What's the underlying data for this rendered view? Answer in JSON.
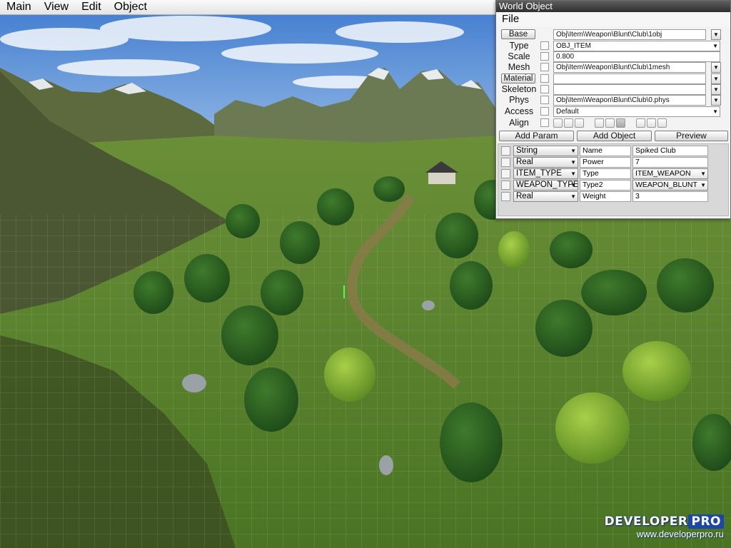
{
  "main_menu": [
    "Main",
    "View",
    "Edit",
    "Object"
  ],
  "world_object": {
    "title": "World Object",
    "menu": [
      "File"
    ],
    "properties": {
      "base": {
        "label": "Base",
        "value": "Obj\\Item\\Weapon\\Blunt\\Club\\1obj"
      },
      "type": {
        "label": "Type",
        "value": "OBJ_ITEM"
      },
      "scale": {
        "label": "Scale",
        "value": "0.800"
      },
      "mesh": {
        "label": "Mesh",
        "value": "Obj\\Item\\Weapon\\Blunt\\Club\\1mesh"
      },
      "material": {
        "label": "Material",
        "value": ""
      },
      "skeleton": {
        "label": "Skeleton",
        "value": ""
      },
      "phys": {
        "label": "Phys",
        "value": "Obj\\Item\\Weapon\\Blunt\\Club\\0.phys"
      },
      "access": {
        "label": "Access",
        "value": "Default"
      },
      "align": {
        "label": "Align"
      }
    },
    "actions": {
      "add_param": "Add Param",
      "add_object": "Add Object",
      "preview": "Preview"
    },
    "params": [
      {
        "type": "String",
        "name": "Name",
        "value": "Spiked Club"
      },
      {
        "type": "Real",
        "name": "Power",
        "value": "7"
      },
      {
        "type": "ITEM_TYPE",
        "name": "Type",
        "value": "ITEM_WEAPON"
      },
      {
        "type": "WEAPON_TYPE",
        "name": "Type2",
        "value": "WEAPON_BLUNT"
      },
      {
        "type": "Real",
        "name": "Weight",
        "value": "3"
      }
    ]
  },
  "watermark": {
    "brand_part1": "DEVELOPER",
    "brand_part2": "PRO",
    "url": "www.developerpro.ru"
  },
  "colors": {
    "sky": "#6f9fd6",
    "grass": "#4f7a2a",
    "titlebar": "#3a3a3a",
    "watermark_blue": "#1c47a6"
  },
  "icons": {
    "dropdown": "dropdown-arrow-icon",
    "ellipsis": "ellipsis-icon"
  }
}
